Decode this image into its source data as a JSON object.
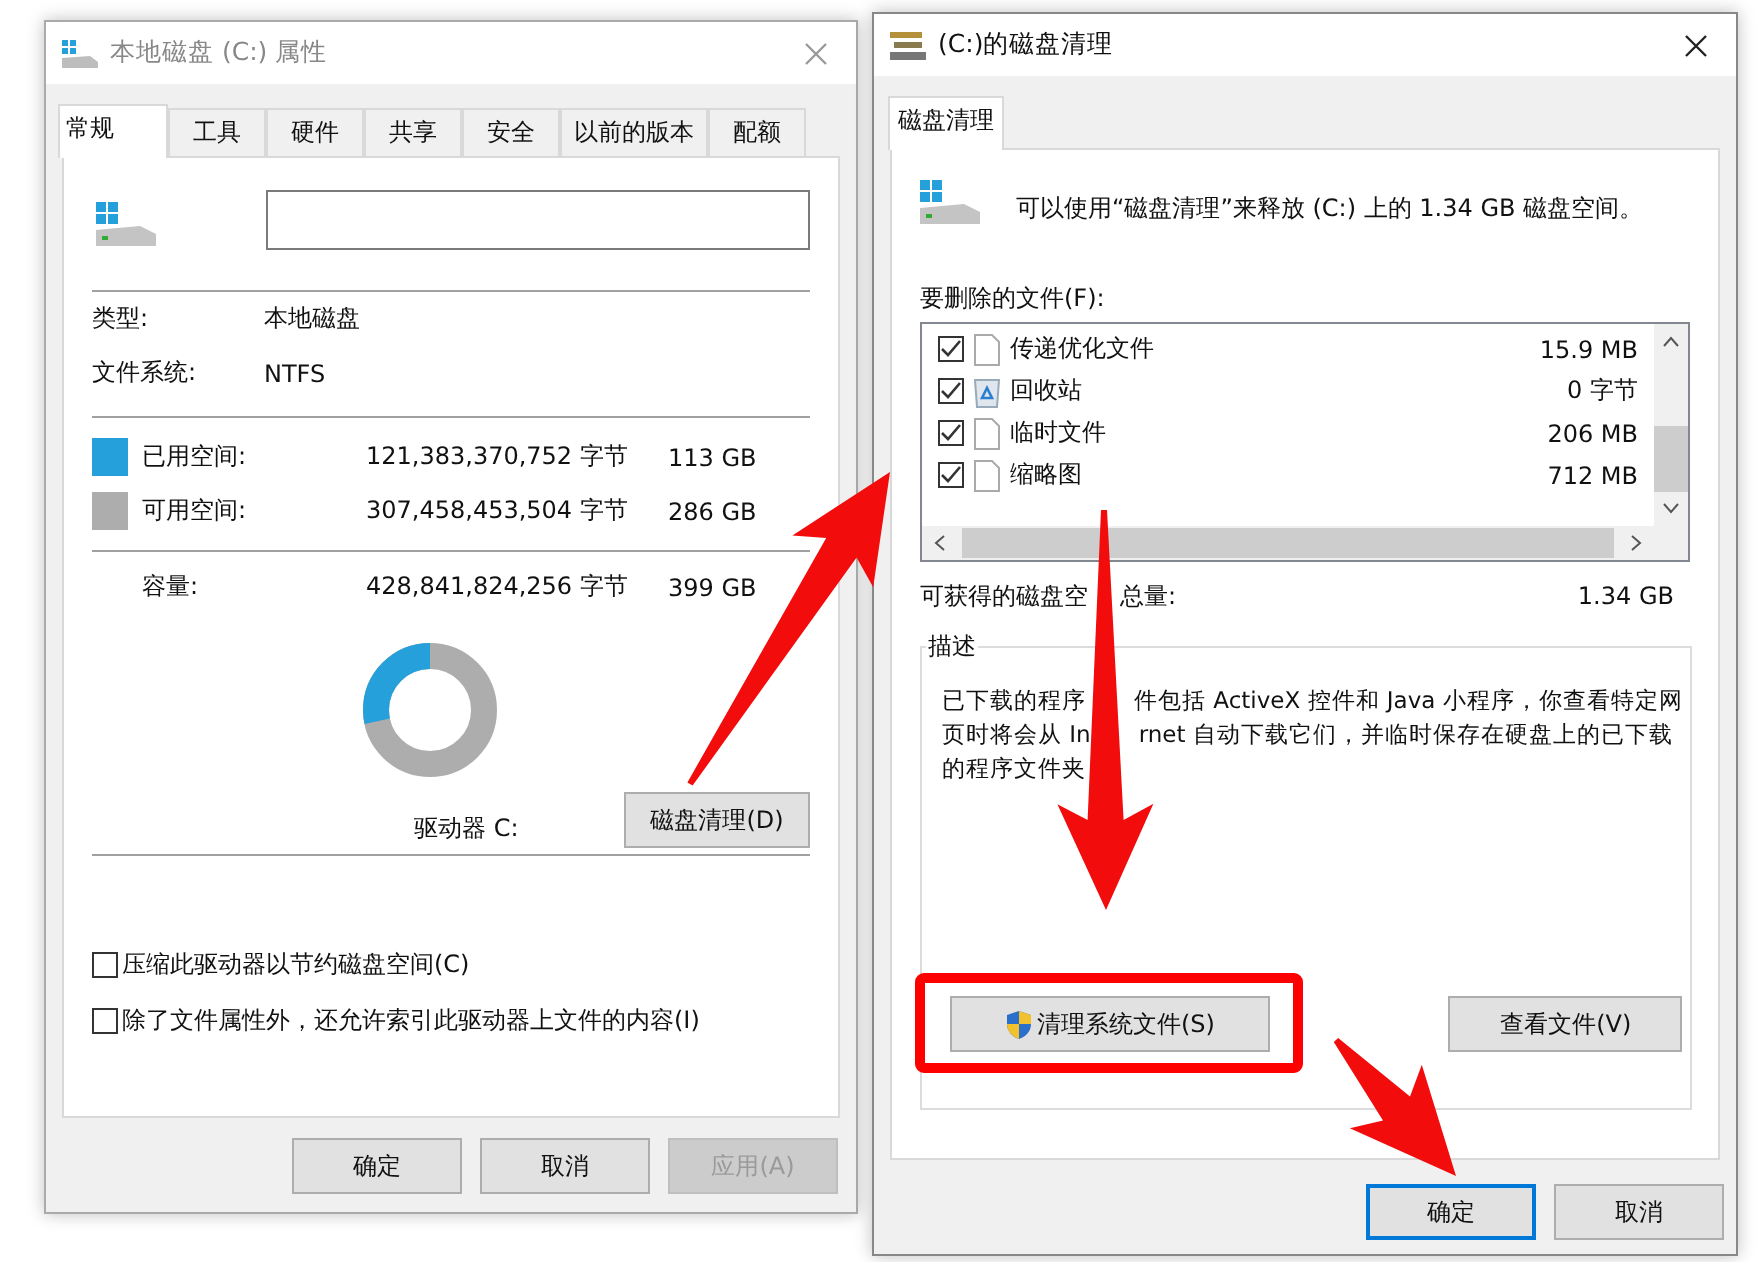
{
  "properties_window": {
    "title": "本地磁盘 (C:) 属性",
    "tabs": [
      {
        "label": "常规",
        "selected": true
      },
      {
        "label": "工具",
        "selected": false
      },
      {
        "label": "硬件",
        "selected": false
      },
      {
        "label": "共享",
        "selected": false
      },
      {
        "label": "安全",
        "selected": false
      },
      {
        "label": "以前的版本",
        "selected": false
      },
      {
        "label": "配额",
        "selected": false
      }
    ],
    "info": [
      {
        "label": "类型:",
        "value": "本地磁盘"
      },
      {
        "label": "文件系统:",
        "value": "NTFS"
      }
    ],
    "space": [
      {
        "label": "已用空间:",
        "bytes": "121,383,370,752 字节",
        "size": "113 GB",
        "color": "#26a0da"
      },
      {
        "label": "可用空间:",
        "bytes": "307,458,453,504 字节",
        "size": "286 GB",
        "color": "#adadad"
      }
    ],
    "capacity": {
      "label": "容量:",
      "bytes": "428,841,824,256 字节",
      "size": "399 GB"
    },
    "usage_ring": {
      "level": 0.283
    },
    "drive_label": "驱动器 C:",
    "cleanup_button": "磁盘清理(D)",
    "options": [
      {
        "label": "压缩此驱动器以节约磁盘空间(C)",
        "checked": false
      },
      {
        "label": "除了文件属性外，还允许索引此驱动器上文件的内容(I)",
        "checked": false
      }
    ],
    "buttons": [
      {
        "label": "确定",
        "disabled": false
      },
      {
        "label": "取消",
        "disabled": false
      },
      {
        "label": "应用(A)",
        "disabled": true
      }
    ]
  },
  "cleanup_window": {
    "title": "(C:)的磁盘清理",
    "tabs": [
      {
        "label": "磁盘清理",
        "selected": true
      }
    ],
    "intro": "可以使用“磁盘清理”来释放  (C:) 上的 1.34 GB 磁盘空间。",
    "files_label": "要删除的文件(F):",
    "files": [
      {
        "name": "传递优化文件",
        "size": "15.9 MB",
        "checked": true,
        "kind": "file"
      },
      {
        "name": "回收站",
        "size": "0 字节",
        "checked": true,
        "kind": "recycle"
      },
      {
        "name": "临时文件",
        "size": "206 MB",
        "checked": true,
        "kind": "file"
      },
      {
        "name": "缩略图",
        "size": "712 MB",
        "checked": true,
        "kind": "file"
      }
    ],
    "total": {
      "label_parts": [
        "可获得的磁盘空",
        "总量:"
      ],
      "value": "1.34 GB"
    },
    "description": {
      "title": "描述",
      "lines": [
        [
          "已下载的程序",
          "件包括 ActiveX 控件和 Java 小程序，你查看特定网"
        ],
        [
          "页时将会从 In",
          "rnet 自动下载它们，并临时保存在硬盘上的已下载"
        ],
        [
          "的程序文件夹"
        ]
      ]
    },
    "action_buttons": [
      {
        "label": "清理系统文件(S)",
        "kind": "shield"
      },
      {
        "label": "查看文件(V)",
        "kind": "plain"
      }
    ],
    "buttons": [
      {
        "label": "确定",
        "default": true
      },
      {
        "label": "取消",
        "default": false
      }
    ]
  }
}
